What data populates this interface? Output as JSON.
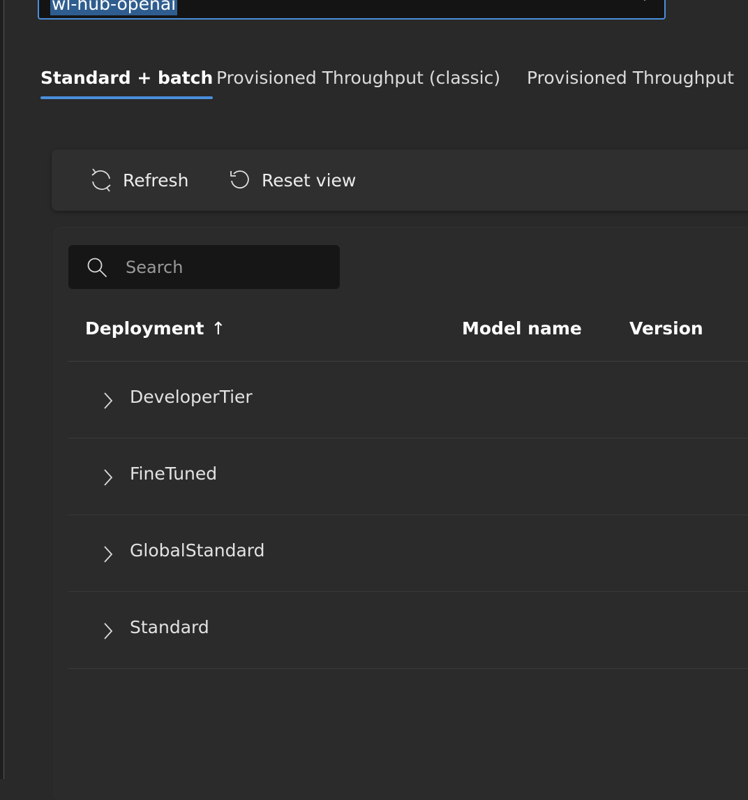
{
  "resource": {
    "selected_value": "wl-hub-openai"
  },
  "tabs": [
    {
      "label": "Standard + batch",
      "active": true
    },
    {
      "label": "Provisioned Throughput (classic)",
      "active": false
    },
    {
      "label": "Provisioned Throughput",
      "active": false
    }
  ],
  "toolbar": {
    "refresh_label": "Refresh",
    "reset_label": "Reset view"
  },
  "search": {
    "placeholder": "Search",
    "value": ""
  },
  "table": {
    "columns": [
      "Deployment",
      "Model name",
      "Version"
    ],
    "sort_indicator": "↑",
    "groups": [
      "DeveloperTier",
      "FineTuned",
      "GlobalStandard",
      "Standard"
    ]
  },
  "colors": {
    "accent": "#4a8fdc",
    "background": "#292929"
  }
}
